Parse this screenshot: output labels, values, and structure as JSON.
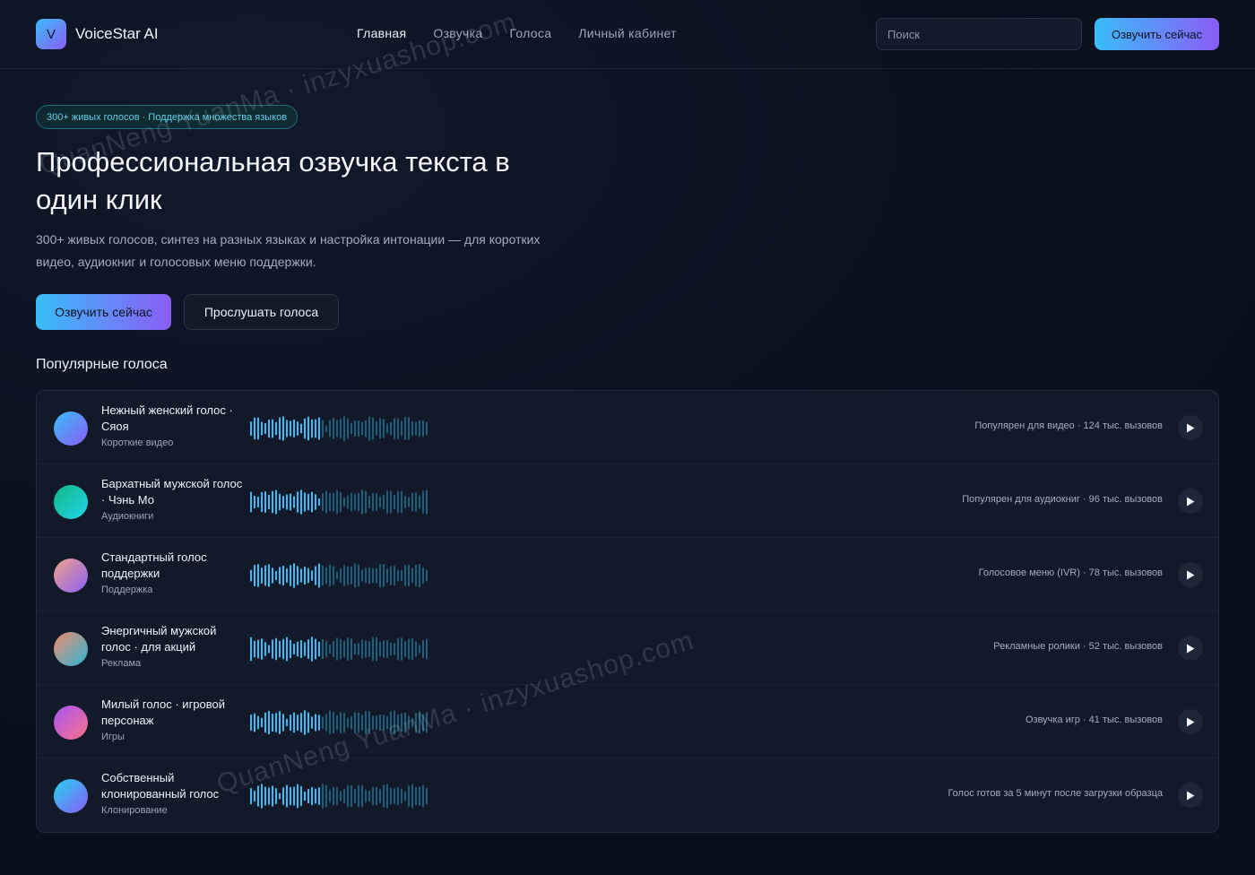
{
  "header": {
    "logo_letter": "V",
    "brand": "VoiceStar AI",
    "nav": [
      {
        "label": "Главная",
        "active": true
      },
      {
        "label": "Озвучка",
        "active": false
      },
      {
        "label": "Голоса",
        "active": false
      },
      {
        "label": "Личный кабинет",
        "active": false
      }
    ],
    "search_placeholder": "Поиск",
    "cta": "Озвучить сейчас"
  },
  "hero": {
    "badge": "300+ живых голосов · Поддержка множества языков",
    "title": "Профессиональная озвучка текста в один клик",
    "subtitle": "300+ живых голосов, синтез на разных языках и настройка интонации — для коротких видео, аудиокниг и голосовых меню поддержки.",
    "primary_button": "Озвучить сейчас",
    "secondary_button": "Прослушать голоса"
  },
  "section_title": "Популярные голоса",
  "voices": [
    {
      "name": "Нежный женский голос · Сяоя",
      "category": "Короткие видео",
      "stats": "Популярен для видео · 124 тыс. вызовов",
      "avatar_colors": [
        "#38bdf8",
        "#8b5cf6"
      ]
    },
    {
      "name": "Бархатный мужской голос · Чэнь Мо",
      "category": "Аудиокниги",
      "stats": "Популярен для аудиокниг · 96 тыс. вызовов",
      "avatar_colors": [
        "#10b981",
        "#22d3ee"
      ]
    },
    {
      "name": "Стандартный голос поддержки",
      "category": "Поддержка",
      "stats": "Голосовое меню (IVR) · 78 тыс. вызовов",
      "avatar_colors": [
        "#f0a58a",
        "#8b5cf6"
      ]
    },
    {
      "name": "Энергичный мужской голос · для акций",
      "category": "Реклама",
      "stats": "Рекламные ролики · 52 тыс. вызовов",
      "avatar_colors": [
        "#f28b6b",
        "#2bb5d8"
      ]
    },
    {
      "name": "Милый голос · игровой персонаж",
      "category": "Игры",
      "stats": "Озвучка игр · 41 тыс. вызовов",
      "avatar_colors": [
        "#a855f7",
        "#fb7185"
      ]
    },
    {
      "name": "Собственный клонированный голос",
      "category": "Клонирование",
      "stats": "Голос готов за 5 минут после загрузки образца",
      "avatar_colors": [
        "#22d3ee",
        "#8b5cf6"
      ]
    }
  ],
  "watermarks": [
    "QuanNeng YuanMa · inzyxuashop.com",
    "QuanNeng YuanMa · inzyxuashop.com"
  ],
  "colors": {
    "accent_from": "#38bdf8",
    "accent_to": "#8b5cf6",
    "wave_active": "#38bdf8",
    "wave_inactive": "#1f5f7a"
  },
  "icons": {
    "play": "play-icon"
  }
}
